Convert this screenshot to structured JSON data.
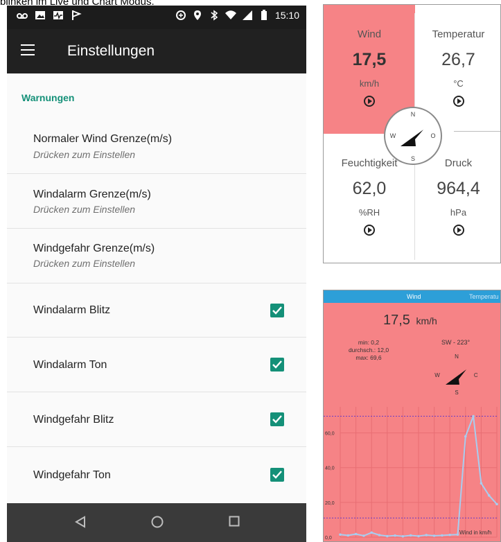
{
  "caption": "blinken im Live und Chart Modus.",
  "status_bar": {
    "time": "15:10"
  },
  "toolbar": {
    "title": "Einstellungen"
  },
  "section_header": "Warnungen",
  "prefs": [
    {
      "title": "Normaler Wind Grenze(m/s)",
      "summary": "Drücken zum Einstellen"
    },
    {
      "title": "Windalarm Grenze(m/s)",
      "summary": "Drücken zum Einstellen"
    },
    {
      "title": "Windgefahr Grenze(m/s)",
      "summary": "Drücken zum Einstellen"
    }
  ],
  "checks": [
    {
      "title": "Windalarm Blitz",
      "checked": true
    },
    {
      "title": "Windalarm Ton",
      "checked": true
    },
    {
      "title": "Windgefahr Blitz",
      "checked": true
    },
    {
      "title": "Windgefahr Ton",
      "checked": true
    }
  ],
  "live": {
    "wind": {
      "label": "Wind",
      "value": "17,5",
      "unit": "km/h"
    },
    "temp": {
      "label": "Temperatur",
      "value": "26,7",
      "unit": "°C"
    },
    "hum": {
      "label": "Feuchtigkeit",
      "value": "62,0",
      "unit": "%RH"
    },
    "press": {
      "label": "Druck",
      "value": "964,4",
      "unit": "hPa"
    },
    "compass": {
      "n": "N",
      "s": "S",
      "w": "W",
      "o": "O"
    }
  },
  "chart_panel": {
    "tab_wind": "Wind",
    "tab_temp": "Temperatu",
    "value": "17,5",
    "unit": "km/h",
    "min": "min: 0,2",
    "avg": "durchsch.: 12,0",
    "max": "max: 69,6",
    "direction": "SW - 223°",
    "compass": {
      "n": "N",
      "s": "S",
      "w": "W",
      "o": "O"
    },
    "legend": "Wind in km/h"
  },
  "chart_data": {
    "type": "line",
    "ylabel": "",
    "yticks": [
      "60,0",
      "40,0",
      "20,0",
      "0,0"
    ],
    "ylim": [
      0,
      75
    ],
    "x": [
      0,
      1,
      2,
      3,
      4,
      5,
      6,
      7,
      8,
      9,
      10,
      11,
      12,
      13,
      14,
      15,
      16,
      17,
      18,
      19,
      20
    ],
    "series": [
      {
        "name": "Wind in km/h",
        "values": [
          1.5,
          1,
          1.8,
          0.8,
          2.6,
          1.2,
          0.6,
          0.9,
          0.5,
          1.0,
          0.6,
          1.2,
          0.8,
          1.0,
          1.3,
          1.5,
          58,
          69.6,
          31,
          24,
          19
        ]
      }
    ],
    "limit_lines": [
      69.6,
      11
    ],
    "grid": true,
    "legend_position": "bottom-right"
  },
  "colors": {
    "accent": "#149078",
    "wind_bg": "#f68386",
    "tab_bar": "#2d9fd8",
    "line": "#a8cdf0"
  }
}
